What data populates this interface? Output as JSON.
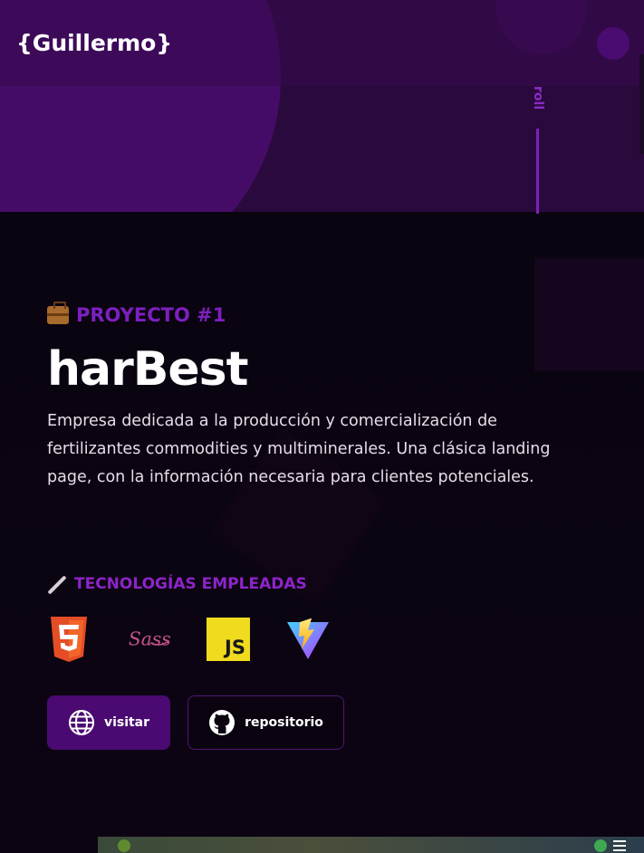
{
  "header": {
    "logo_text": "{Guillermo}"
  },
  "scroll_indicator": {
    "label": "roll"
  },
  "project": {
    "kicker": "PROYECTO #1",
    "title": "harBest",
    "description": "Empresa dedicada a la producción y comercialización de fertilizantes commodities y multiminerales. Una clásica landing page, con la información necesaria para clientes potenciales."
  },
  "technologies": {
    "heading": "TECNOLOGÍAS EMPLEADAS",
    "items": [
      {
        "icon": "html5-icon",
        "color": "#e44d26",
        "label": "5"
      },
      {
        "icon": "sass-icon",
        "color": "#c6538c",
        "label": "Sass"
      },
      {
        "icon": "javascript-icon",
        "color": "#f0db1e",
        "label": "JS"
      },
      {
        "icon": "vite-icon",
        "color": "#8f5cff"
      }
    ]
  },
  "buttons": {
    "visit_label": "visitar",
    "repo_label": "repositorio"
  },
  "colors": {
    "accent": "#7d1fc0",
    "button_primary": "#4a0a72",
    "background": "#0b0410"
  }
}
